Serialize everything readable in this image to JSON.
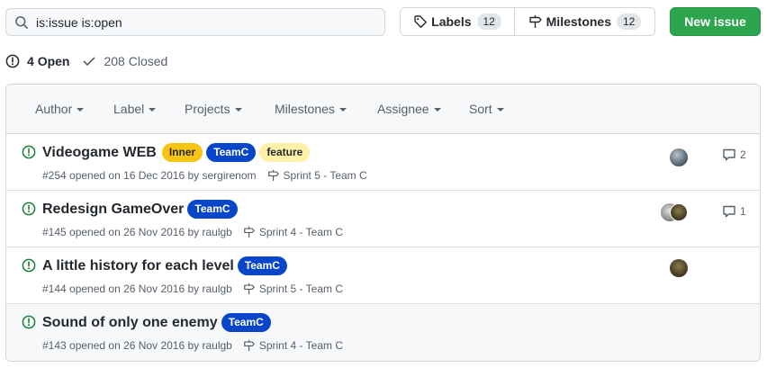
{
  "search": {
    "value": "is:issue is:open",
    "icon": "search-icon"
  },
  "header_buttons": {
    "labels": {
      "label": "Labels",
      "count": "12",
      "icon": "tag-icon"
    },
    "milestones": {
      "label": "Milestones",
      "count": "12",
      "icon": "milestone-icon"
    },
    "new_issue": "New issue"
  },
  "states": {
    "open": {
      "count": "4",
      "label": "Open"
    },
    "closed": {
      "count": "208",
      "label": "Closed"
    }
  },
  "filters": [
    "Author",
    "Label",
    "Projects",
    "Milestones",
    "Assignee",
    "Sort"
  ],
  "issues": [
    {
      "title": "Videogame WEB",
      "labels": [
        {
          "name": "Inner",
          "bg": "#f9c513",
          "fg": "#24292f"
        },
        {
          "name": "TeamC",
          "bg": "#0846c9",
          "fg": "#ffffff"
        },
        {
          "name": "feature",
          "bg": "#fff1a8",
          "fg": "#24292f"
        }
      ],
      "meta": "#254 opened on 16 Dec 2016 by sergirenom",
      "milestone": "Sprint 5 - Team C",
      "comments": "2"
    },
    {
      "title": "Redesign GameOver",
      "labels": [
        {
          "name": "TeamC",
          "bg": "#0846c9",
          "fg": "#ffffff"
        }
      ],
      "meta": "#145 opened on 26 Nov 2016 by raulgb",
      "milestone": "Sprint 4 - Team C",
      "comments": "1"
    },
    {
      "title": "A little history for each level",
      "labels": [
        {
          "name": "TeamC",
          "bg": "#0846c9",
          "fg": "#ffffff"
        }
      ],
      "meta": "#144 opened on 26 Nov 2016 by raulgb",
      "milestone": "Sprint 5 - Team C",
      "comments": ""
    },
    {
      "title": "Sound of only one enemy",
      "labels": [
        {
          "name": "TeamC",
          "bg": "#0846c9",
          "fg": "#ffffff"
        }
      ],
      "meta": "#143 opened on 26 Nov 2016 by raulgb",
      "milestone": "Sprint 4 - Team C",
      "comments": ""
    }
  ],
  "colors": {
    "open_green": "#1a7f37",
    "button_green": "#2da44e",
    "muted": "#57606a",
    "border": "#d0d7de"
  }
}
